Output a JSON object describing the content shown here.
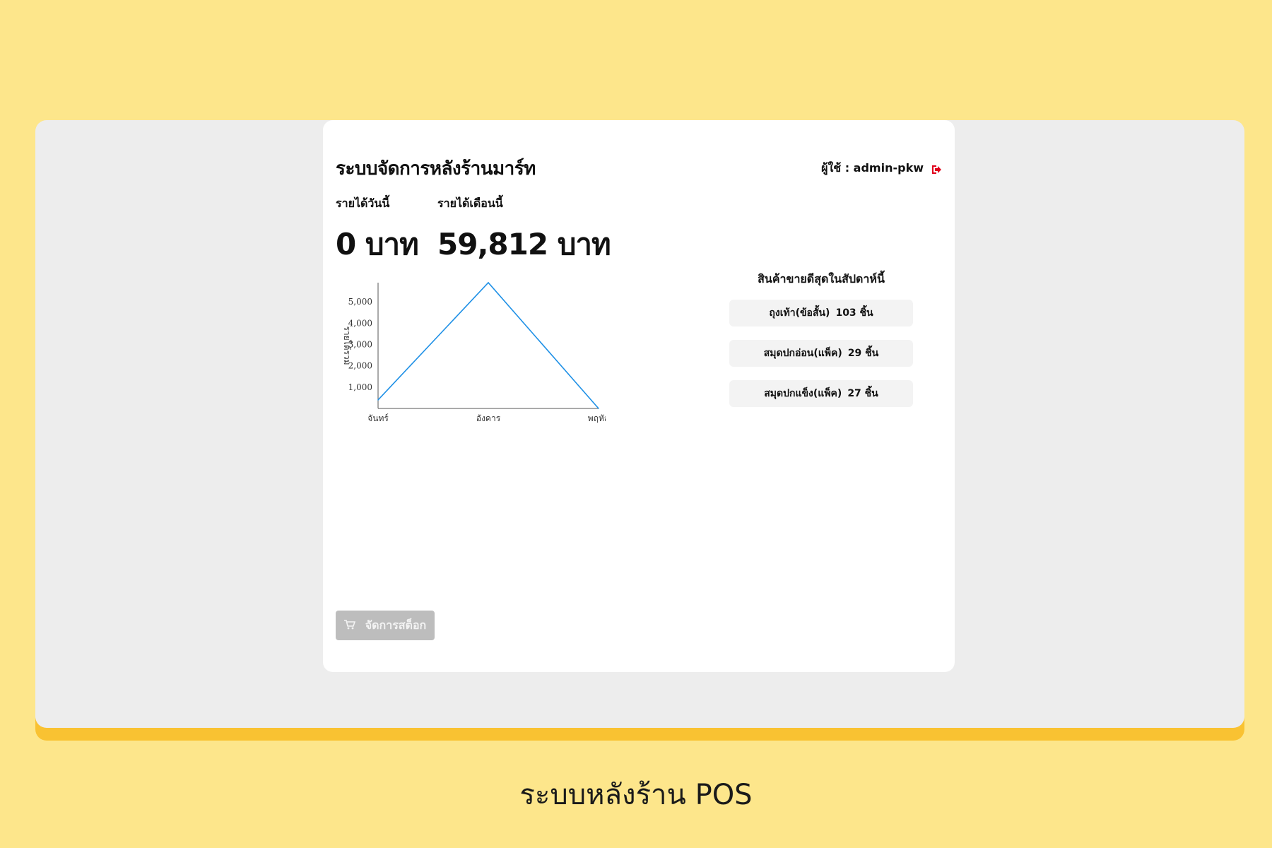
{
  "header": {
    "title": "ระบบจัดการหลังร้านมาร์ท",
    "user_label": "ผู้ใช้ : admin-pkw",
    "logout_icon": "logout-icon"
  },
  "stats": {
    "today_label": "รายได้วันนี้",
    "today_value": "0 บาท",
    "month_label": "รายได้เดือนนี้",
    "month_value": "59,812 บาท"
  },
  "chart_data": {
    "type": "line",
    "categories": [
      "จันทร์",
      "อังคาร",
      "พฤหัส"
    ],
    "series": [
      {
        "values": [
          400,
          5900,
          0
        ],
        "color": "#1e90e6"
      }
    ],
    "ylabel": "รายได้รวม",
    "yticks": [
      1000,
      2000,
      3000,
      4000,
      5000
    ],
    "ytick_labels": [
      "1,000",
      "2,000",
      "3,000",
      "4,000",
      "5,000"
    ],
    "ylim": [
      0,
      5900
    ],
    "grid": false,
    "legend": "none"
  },
  "best_sellers": {
    "title": "สินค้าขายดีสุดในสัปดาห์นี้",
    "items": [
      {
        "name": "ถุงเท้า(ข้อสั้น)",
        "qty": "103 ชิ้น"
      },
      {
        "name": "สมุดปกอ่อน(แพ็ค)",
        "qty": "29 ชิ้น"
      },
      {
        "name": "สมุดปกแข็ง(แพ็ค)",
        "qty": "27 ชิ้น"
      }
    ]
  },
  "stock_button": {
    "label": "จัดการสต็อก",
    "icon": "cart-icon"
  },
  "caption": "ระบบหลังร้าน POS",
  "colors": {
    "page_bg": "#fde68b",
    "frame_bg": "#ededed",
    "frame_accent": "#f9c232",
    "line": "#1e90e6",
    "logout": "#e0001b",
    "button_bg": "#bdbdbd"
  }
}
